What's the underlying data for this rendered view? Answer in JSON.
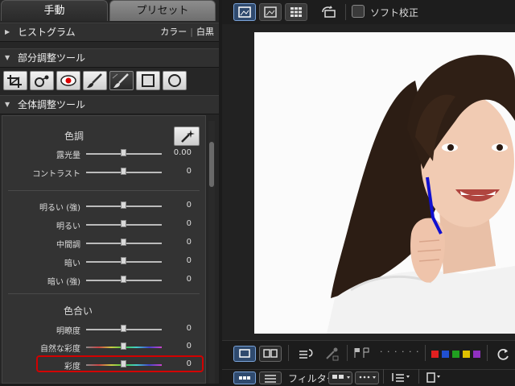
{
  "tabs": {
    "manual": "手動",
    "preset": "プリセット"
  },
  "histogram": {
    "title": "ヒストグラム",
    "color": "カラー",
    "sep": "|",
    "mono": "白黒"
  },
  "partial": {
    "title": "部分調整ツール"
  },
  "overall": {
    "title": "全体調整ツール"
  },
  "tone": {
    "title": "色調",
    "sliders": [
      {
        "label": "露光量",
        "value": "0.00"
      },
      {
        "label": "コントラスト",
        "value": "0"
      }
    ]
  },
  "light": {
    "sliders": [
      {
        "label": "明るい (強)",
        "value": "0"
      },
      {
        "label": "明るい",
        "value": "0"
      },
      {
        "label": "中間調",
        "value": "0"
      },
      {
        "label": "暗い",
        "value": "0"
      },
      {
        "label": "暗い (強)",
        "value": "0"
      }
    ]
  },
  "hue": {
    "title": "色合い",
    "sliders": [
      {
        "label": "明瞭度",
        "value": "0"
      },
      {
        "label": "自然な彩度",
        "value": "0"
      },
      {
        "label": "彩度",
        "value": "0"
      }
    ]
  },
  "topbar": {
    "soft_proof": "ソフト校正"
  },
  "bottombar": {
    "filter": "フィルター:",
    "dots": "· · · · · ·"
  },
  "colors": {
    "highlight": "#d20000",
    "flag_colors": [
      "#e02020",
      "#2050d0",
      "#20a020",
      "#e0c000",
      "#9030c0"
    ]
  }
}
